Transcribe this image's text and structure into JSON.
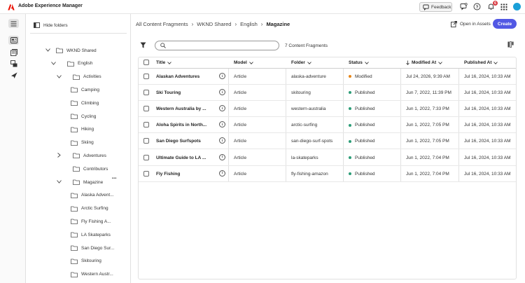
{
  "colors": {
    "accent": "#5258e4",
    "modified": "#e68619",
    "published": "#2d9d78",
    "adobe_red": "#eb1000"
  },
  "header": {
    "app_title": "Adobe Experience Manager",
    "feedback_label": "Feedback",
    "notification_count": "6"
  },
  "rail": {
    "items": [
      "menu-icon",
      "content-fragments-icon",
      "assets-icon",
      "folders-icon",
      "launch-icon"
    ]
  },
  "tree": {
    "hide_folders_label": "Hide folders",
    "nodes": [
      {
        "label": "WKND Shared",
        "depth": 0,
        "expanded": true
      },
      {
        "label": "English",
        "depth": 1,
        "expanded": true
      },
      {
        "label": "Activities",
        "depth": 2,
        "expanded": true
      },
      {
        "label": "Camping",
        "depth": 3
      },
      {
        "label": "Climbing",
        "depth": 3
      },
      {
        "label": "Cycling",
        "depth": 3
      },
      {
        "label": "Hiking",
        "depth": 3
      },
      {
        "label": "Skiing",
        "depth": 3
      },
      {
        "label": "Adventures",
        "depth": 2,
        "expanded": false
      },
      {
        "label": "Contributors",
        "depth": 2
      },
      {
        "label": "Magazine",
        "depth": 2,
        "expanded": true
      },
      {
        "label": "Alaska Advent...",
        "depth": 3
      },
      {
        "label": "Arctic Surfing",
        "depth": 3
      },
      {
        "label": "Fly Fishing A...",
        "depth": 3
      },
      {
        "label": "LA Skateparks",
        "depth": 3
      },
      {
        "label": "San Diego Sur...",
        "depth": 3
      },
      {
        "label": "Skitouring",
        "depth": 3
      },
      {
        "label": "Western Austr...",
        "depth": 3
      }
    ]
  },
  "main": {
    "breadcrumb": [
      "All Content Fragments",
      "WKND Shared",
      "English",
      "Magazine"
    ],
    "open_in_assets_label": "Open in Assets",
    "create_label": "Create",
    "search_placeholder": "",
    "count_label": "7 Content Fragments",
    "columns": [
      "Title",
      "Model",
      "Folder",
      "Status",
      "Modified At",
      "Published At"
    ],
    "rows": [
      {
        "title": "Alaskan Adventures",
        "model": "Article",
        "folder": "alaska-adventure",
        "status": "Modified",
        "modified": "Jul 24, 2026, 9:39 AM",
        "published": "Jul 16, 2024, 10:33 AM"
      },
      {
        "title": "Ski Touring",
        "model": "Article",
        "folder": "skitouring",
        "status": "Published",
        "modified": "Jun 7, 2022, 11:39 PM",
        "published": "Jul 16, 2024, 10:33 AM"
      },
      {
        "title": "Western Australia by ...",
        "model": "Article",
        "folder": "western-australia",
        "status": "Published",
        "modified": "Jun 1, 2022, 7:33 PM",
        "published": "Jul 16, 2024, 10:33 AM"
      },
      {
        "title": "Aloha Spirits in North...",
        "model": "Article",
        "folder": "arctic-surfing",
        "status": "Published",
        "modified": "Jun 1, 2022, 7:05 PM",
        "published": "Jul 16, 2024, 10:33 AM"
      },
      {
        "title": "San Diego Surfspots",
        "model": "Article",
        "folder": "san-diego-surf-spots",
        "status": "Published",
        "modified": "Jun 1, 2022, 7:05 PM",
        "published": "Jul 16, 2024, 10:33 AM"
      },
      {
        "title": "Ultimate Guide to LA ...",
        "model": "Article",
        "folder": "la-skateparks",
        "status": "Published",
        "modified": "Jun 1, 2022, 7:04 PM",
        "published": "Jul 16, 2024, 10:33 AM"
      },
      {
        "title": "Fly Fishing",
        "model": "Article",
        "folder": "fly-fishing-amazon",
        "status": "Published",
        "modified": "Jun 1, 2022, 7:04 PM",
        "published": "Jul 16, 2024, 10:33 AM"
      }
    ]
  }
}
